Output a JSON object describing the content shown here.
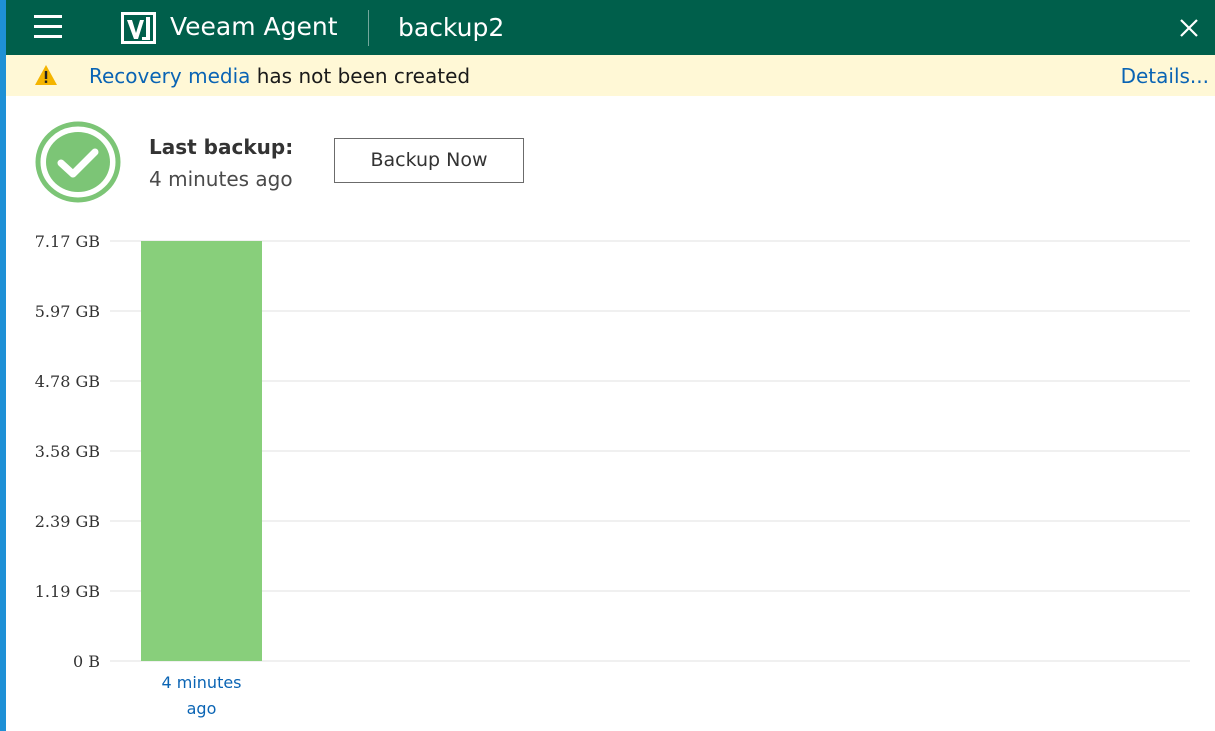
{
  "window": {
    "app_title": "Veeam Agent",
    "job_title": "backup2",
    "menu_icon": "hamburger-menu-icon",
    "logo_icon": "veeam-logo-icon",
    "close_icon": "close-icon"
  },
  "banner": {
    "icon": "warning-icon",
    "link_text": "Recovery media",
    "message": " has not been created",
    "details_link": "Details..."
  },
  "status": {
    "icon": "success-check-icon",
    "last_backup_label": "Last backup:",
    "last_backup_value": "4 minutes ago",
    "backup_now_label": "Backup Now"
  },
  "colors": {
    "titlebar": "#005f4b",
    "banner_bg": "#fff8d6",
    "link": "#0a64b4",
    "bar": "#88cf7b",
    "success": "#7cc576",
    "gridline": "#e2e2e2"
  },
  "chart_data": {
    "type": "bar",
    "categories": [
      "4 minutes ago"
    ],
    "category_label_lines": [
      [
        "4 minutes",
        "ago"
      ]
    ],
    "values": [
      7.17
    ],
    "unit": "GB",
    "y_ticks": [
      "0 B",
      "1.19 GB",
      "2.39 GB",
      "3.58 GB",
      "4.78 GB",
      "5.97 GB",
      "7.17 GB"
    ],
    "ylim": [
      0,
      7.17
    ],
    "grid": true,
    "title": "",
    "xlabel": "",
    "ylabel": ""
  }
}
